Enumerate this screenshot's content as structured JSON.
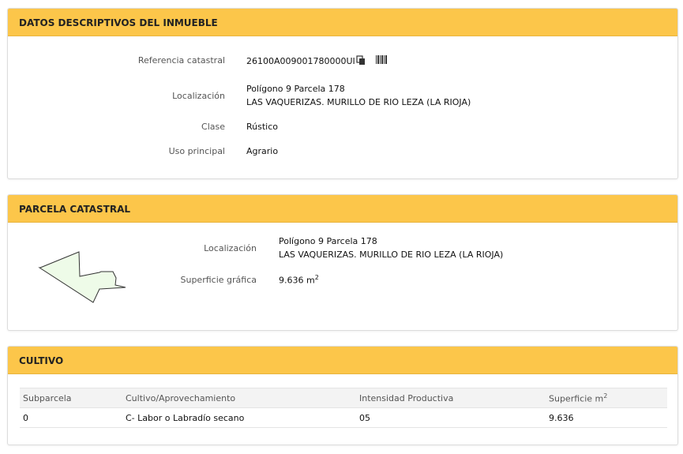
{
  "datos": {
    "title": "DATOS DESCRIPTIVOS DEL INMUEBLE",
    "ref_label": "Referencia catastral",
    "ref_value": "26100A009001780000UI",
    "loc_label": "Localización",
    "loc_line1": "Polígono 9 Parcela 178",
    "loc_line2": "LAS VAQUERIZAS. MURILLO DE RIO LEZA (LA RIOJA)",
    "clase_label": "Clase",
    "clase_value": "Rústico",
    "uso_label": "Uso principal",
    "uso_value": "Agrario"
  },
  "parcela": {
    "title": "PARCELA CATASTRAL",
    "loc_label": "Localización",
    "loc_line1": "Polígono 9 Parcela 178",
    "loc_line2": "LAS VAQUERIZAS. MURILLO DE RIO LEZA (LA RIOJA)",
    "sup_label": "Superficie gráfica",
    "sup_value": "9.636 m",
    "sup_exp": "2"
  },
  "cultivo": {
    "title": "CULTIVO",
    "headers": {
      "subparcela": "Subparcela",
      "cultivo": "Cultivo/Aprovechamiento",
      "intensidad": "Intensidad Productiva",
      "superficie": "Superficie m",
      "superficie_exp": "2"
    },
    "rows": [
      {
        "subparcela": "0",
        "cultivo": "C- Labor o Labradío secano",
        "intensidad": "05",
        "superficie": "9.636"
      }
    ]
  },
  "icons": {
    "copy": "copy-icon",
    "barcode": "barcode-icon",
    "parcel": "parcel-shape-icon"
  },
  "colors": {
    "header_bg": "#fcc64a",
    "parcel_fill": "#eefbe8"
  }
}
